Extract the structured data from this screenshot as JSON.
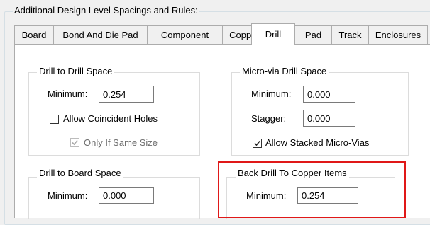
{
  "outer_group": {
    "title": "Additional Design Level Spacings and Rules:"
  },
  "tabs": [
    {
      "label": "Board",
      "active": false
    },
    {
      "label": "Bond And Die Pad",
      "active": false
    },
    {
      "label": "Component",
      "active": false
    },
    {
      "label": "Copper",
      "active": false
    },
    {
      "label": "Drill",
      "active": true
    },
    {
      "label": "Pad",
      "active": false
    },
    {
      "label": "Track",
      "active": false
    },
    {
      "label": "Enclosures",
      "active": false
    }
  ],
  "drill_to_drill": {
    "title": "Drill to Drill Space",
    "minimum_label": "Minimum:",
    "minimum_value": "0.254",
    "allow_coincident_label": "Allow Coincident Holes",
    "allow_coincident_checked": false,
    "only_same_size_label": "Only If Same Size",
    "only_same_size_checked": true,
    "only_same_size_enabled": false
  },
  "micro_via": {
    "title": "Micro-via Drill Space",
    "minimum_label": "Minimum:",
    "minimum_value": "0.000",
    "stagger_label": "Stagger:",
    "stagger_value": "0.000",
    "allow_stacked_label": "Allow Stacked Micro-Vias",
    "allow_stacked_checked": true
  },
  "drill_to_board": {
    "title": "Drill to Board Space",
    "minimum_label": "Minimum:",
    "minimum_value": "0.000"
  },
  "back_drill": {
    "title": "Back Drill To Copper Items",
    "minimum_label": "Minimum:",
    "minimum_value": "0.254",
    "highlight_color": "#e01818"
  }
}
